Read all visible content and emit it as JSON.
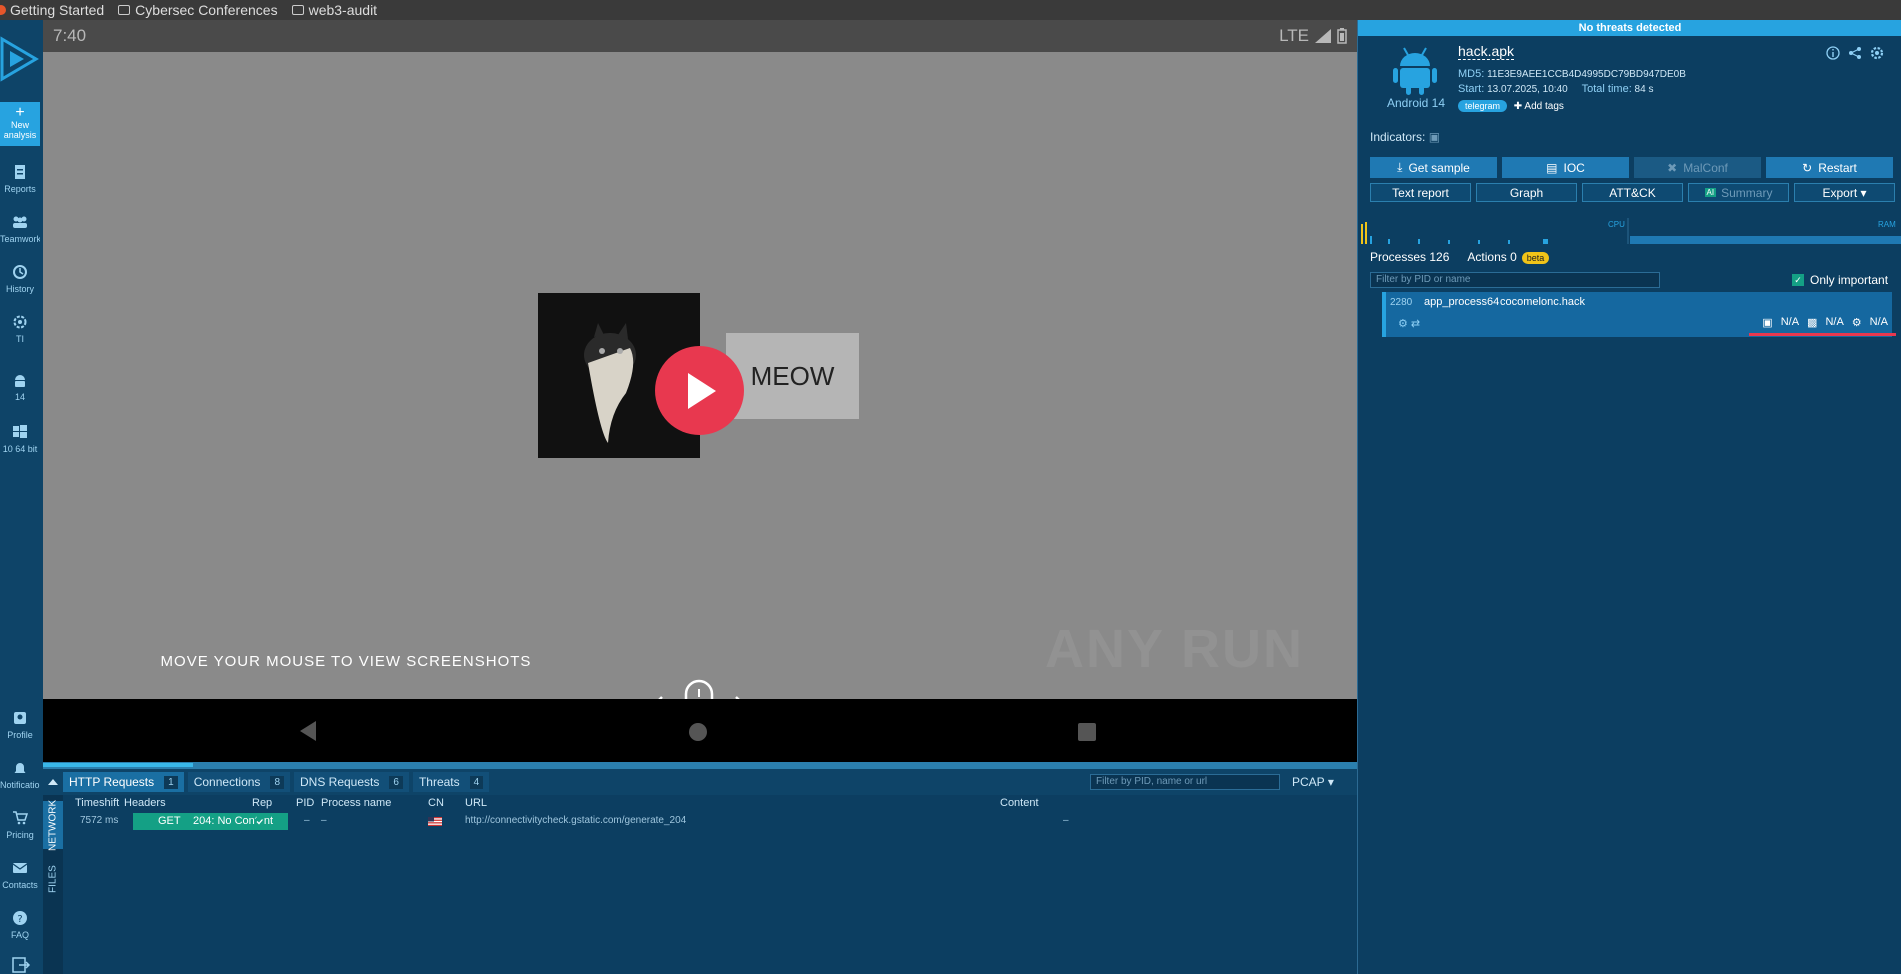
{
  "bookmarks": [
    "Getting Started",
    "Cybersec Conferences",
    "web3-audit"
  ],
  "sidebar": {
    "new_analysis": "New analysis",
    "items": [
      "Reports",
      "Teamwork",
      "History",
      "TI",
      "14",
      "10 64 bit"
    ],
    "bottom_items": [
      "Profile",
      "Notifications",
      "Pricing",
      "Contacts",
      "FAQ"
    ]
  },
  "device": {
    "time": "7:40",
    "network": "LTE",
    "meow_label": "MEOW",
    "watermark": "ANY RUN",
    "hint": "MOVE YOUR MOUSE TO VIEW SCREENSHOTS"
  },
  "network": {
    "tabs": [
      {
        "label": "HTTP Requests",
        "count": "1"
      },
      {
        "label": "Connections",
        "count": "8"
      },
      {
        "label": "DNS Requests",
        "count": "6"
      },
      {
        "label": "Threats",
        "count": "4"
      }
    ],
    "filter_placeholder": "Filter by PID, name or url",
    "pcap": "PCAP",
    "side_tabs": [
      "NETWORK",
      "FILES"
    ],
    "columns": [
      "Timeshift",
      "Headers",
      "Rep",
      "PID",
      "Process name",
      "CN",
      "URL",
      "Content"
    ],
    "rows": [
      {
        "timeshift": "7572 ms",
        "method": "GET",
        "status": "204: No Content",
        "pid": "–",
        "process": "–",
        "url": "http://connectivitycheck.gstatic.com/generate_204",
        "content": "–"
      }
    ]
  },
  "analysis": {
    "threat_status": "No threats detected",
    "os": "Android 14",
    "filename": "hack.apk",
    "md5_label": "MD5:",
    "md5": "11E3E9AEE1CCB4D4995DC79BD947DE0B",
    "start_label": "Start:",
    "start": "13.07.2025, 10:40",
    "total_label": "Total time:",
    "total": "84 s",
    "tag": "telegram",
    "add_tags": "Add tags",
    "indicators_label": "Indicators:",
    "buttons_row1": [
      "Get sample",
      "IOC",
      "MalConf",
      "Restart"
    ],
    "buttons_row2": [
      "Text report",
      "Graph",
      "ATT&CK",
      "Summary",
      "Export"
    ],
    "cpu_label": "CPU",
    "ram_label": "RAM",
    "processes_label": "Processes 126",
    "actions_label": "Actions 0",
    "beta": "beta",
    "process_filter_placeholder": "Filter by PID or name",
    "only_important": "Only important",
    "process": {
      "pid": "2280",
      "name": "app_process64",
      "cmd": "cocomelonc.hack",
      "stat1": "N/A",
      "stat2": "N/A",
      "stat3": "N/A"
    }
  }
}
